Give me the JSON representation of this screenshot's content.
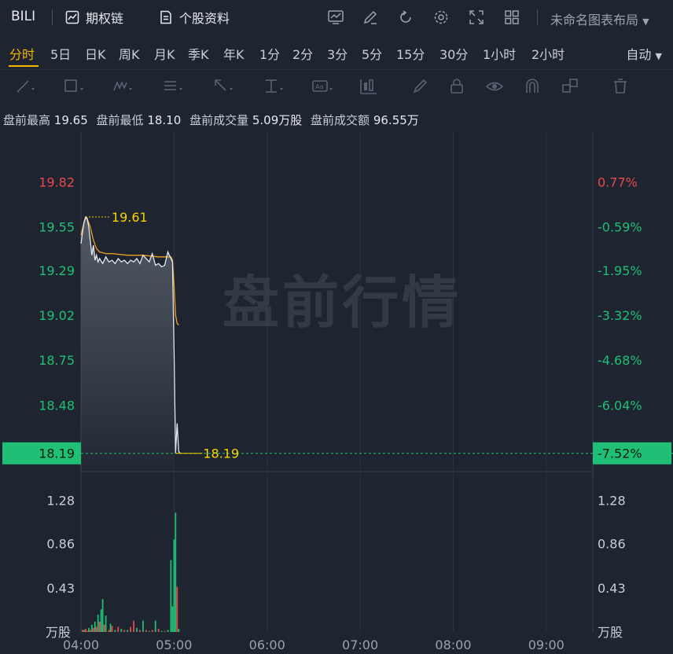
{
  "header": {
    "ticker": "BILI",
    "option_chain_label": "期权链",
    "profile_label": "个股资料",
    "layout_name": "未命名图表布局"
  },
  "periods": [
    "分时",
    "5日",
    "日K",
    "周K",
    "月K",
    "季K",
    "年K",
    "1分",
    "2分",
    "3分",
    "5分",
    "15分",
    "30分",
    "1小时",
    "2小时"
  ],
  "active_period": "分时",
  "auto_label": "自动",
  "premarket": {
    "high_label": "盘前最高",
    "high": "19.65",
    "low_label": "盘前最低",
    "low": "18.10",
    "volume_label": "盘前成交量",
    "volume": "5.09万股",
    "amount_label": "盘前成交额",
    "amount": "96.55万"
  },
  "watermark": "盘前行情",
  "colors": {
    "up": "#e8484e",
    "down": "#1fbf75",
    "price_line": "#e6e9ef",
    "avg_line": "#f0a020",
    "label_yellow": "#f5d400",
    "current_badge": "#1fbf75"
  },
  "chart_data": {
    "type": "line",
    "price_axis": {
      "left_ticks": [
        "19.82",
        "19.55",
        "19.29",
        "19.02",
        "18.75",
        "18.48"
      ],
      "right_ticks": [
        "0.77%",
        "-0.59%",
        "-1.95%",
        "-3.32%",
        "-4.68%",
        "-6.04%"
      ],
      "tick_values": [
        19.82,
        19.55,
        19.29,
        19.02,
        18.75,
        18.48
      ],
      "current_price": "18.19",
      "current_pct": "-7.52%",
      "current_value": 18.19,
      "high_marker": "19.61",
      "high_value": 19.61,
      "low_marker": "18.19",
      "ylim": [
        18.08,
        20.12
      ]
    },
    "volume_axis": {
      "ticks": [
        "1.28",
        "0.86",
        "0.43"
      ],
      "tick_values": [
        1.28,
        0.86,
        0.43
      ],
      "unit": "万股",
      "ylim": [
        0,
        1.56
      ]
    },
    "time_axis": {
      "labels": [
        "04:00",
        "05:00",
        "06:00",
        "07:00",
        "08:00",
        "09:00"
      ],
      "minutes": [
        0,
        60,
        120,
        180,
        240,
        300
      ],
      "range_minutes": [
        0,
        330
      ]
    },
    "series": [
      {
        "name": "price",
        "x": [
          0,
          1,
          2,
          3,
          4,
          5,
          6,
          7,
          8,
          9,
          10,
          11,
          12,
          14,
          16,
          18,
          20,
          22,
          24,
          26,
          28,
          30,
          32,
          34,
          36,
          38,
          40,
          42,
          44,
          46,
          48,
          50,
          52,
          54,
          56,
          58,
          59,
          60,
          61,
          62,
          63,
          64
        ],
        "y": [
          19.45,
          19.52,
          19.58,
          19.61,
          19.6,
          19.55,
          19.47,
          19.38,
          19.44,
          19.35,
          19.38,
          19.34,
          19.36,
          19.33,
          19.37,
          19.34,
          19.35,
          19.33,
          19.36,
          19.34,
          19.35,
          19.33,
          19.35,
          19.34,
          19.36,
          19.33,
          19.38,
          19.36,
          19.34,
          19.39,
          19.32,
          19.33,
          19.31,
          19.32,
          19.4,
          19.36,
          19.34,
          18.8,
          18.19,
          18.37,
          18.2,
          18.19
        ]
      },
      {
        "name": "avg",
        "x": [
          0,
          2,
          3,
          4,
          6,
          8,
          10,
          12,
          16,
          20,
          30,
          40,
          50,
          56,
          58,
          59,
          60,
          61,
          62,
          63
        ],
        "y": [
          19.5,
          19.58,
          19.6,
          19.6,
          19.55,
          19.47,
          19.42,
          19.4,
          19.39,
          19.39,
          19.38,
          19.38,
          19.37,
          19.37,
          19.37,
          19.35,
          19.2,
          19.02,
          18.97,
          18.96
        ]
      }
    ],
    "volume": {
      "x": [
        1,
        2,
        3,
        4,
        5,
        6,
        7,
        8,
        9,
        10,
        11,
        12,
        13,
        14,
        15,
        16,
        18,
        19,
        20,
        22,
        24,
        26,
        28,
        30,
        32,
        34,
        36,
        38,
        40,
        42,
        44,
        46,
        48,
        50,
        52,
        54,
        56,
        58,
        59,
        60,
        61,
        62,
        63
      ],
      "v": [
        0.02,
        0.02,
        0.03,
        0.01,
        0.04,
        0.02,
        0.07,
        0.04,
        0.1,
        0.05,
        0.17,
        0.1,
        0.22,
        0.32,
        0.07,
        0.16,
        0.02,
        0.08,
        0.06,
        0.02,
        0.05,
        0.03,
        0.02,
        0.02,
        0.05,
        0.11,
        0.04,
        0.02,
        0.11,
        0.02,
        0.01,
        0.02,
        0.11,
        0.03,
        0.01,
        0.01,
        0.02,
        0.7,
        0.25,
        0.9,
        1.16,
        0.44,
        0.03
      ],
      "dir": [
        "u",
        "d",
        "u",
        "u",
        "d",
        "u",
        "d",
        "u",
        "d",
        "u",
        "d",
        "u",
        "d",
        "d",
        "u",
        "d",
        "u",
        "d",
        "u",
        "d",
        "u",
        "d",
        "u",
        "d",
        "u",
        "u",
        "d",
        "u",
        "d",
        "u",
        "d",
        "u",
        "d",
        "u",
        "d",
        "u",
        "d",
        "d",
        "d",
        "d",
        "d",
        "u",
        "d"
      ]
    }
  }
}
